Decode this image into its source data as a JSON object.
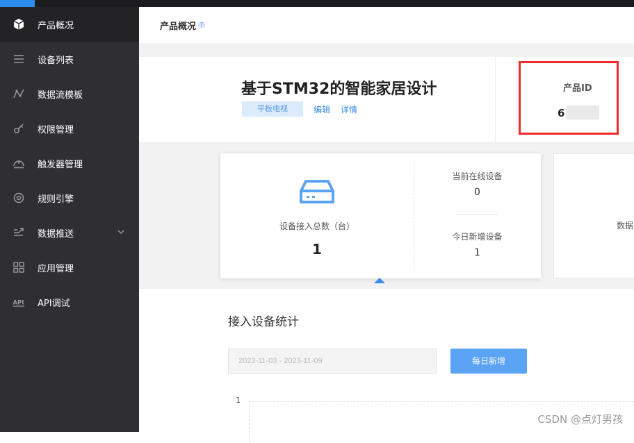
{
  "sidebar": {
    "items": [
      {
        "label": "产品概况",
        "icon": "cube-icon"
      },
      {
        "label": "设备列表",
        "icon": "list-icon"
      },
      {
        "label": "数据流模板",
        "icon": "dataflow-icon"
      },
      {
        "label": "权限管理",
        "icon": "key-icon"
      },
      {
        "label": "触发器管理",
        "icon": "trigger-icon"
      },
      {
        "label": "规则引擎",
        "icon": "rule-engine-icon"
      },
      {
        "label": "数据推送",
        "icon": "push-icon"
      },
      {
        "label": "应用管理",
        "icon": "grid-icon"
      },
      {
        "label": "API调试",
        "icon": "api-icon"
      }
    ]
  },
  "header": {
    "title": "产品概况",
    "help": "?"
  },
  "product": {
    "name": "基于STM32的智能家居设计",
    "tag": "平板电视",
    "edit_label": "编辑",
    "detail_label": "详情",
    "id_label": "产品ID",
    "id_value": "61"
  },
  "stats": {
    "total_label": "设备接入总数（台）",
    "total_value": "1",
    "online_label": "当前在线设备",
    "online_value": "0",
    "today_label": "今日新增设备",
    "today_value": "1",
    "right_card_label": "数据"
  },
  "section": {
    "title": "接入设备统计",
    "date_range": "2023-11-03 - 2023-11-09",
    "daily_button": "每日新增",
    "y_tick": "1"
  },
  "watermark": "CSDN @点灯男孩",
  "colors": {
    "accent": "#2d8cf0",
    "sidebar_bg": "#2f2f33",
    "button": "#5aa3f5",
    "highlight_box": "#ee2a2a"
  }
}
